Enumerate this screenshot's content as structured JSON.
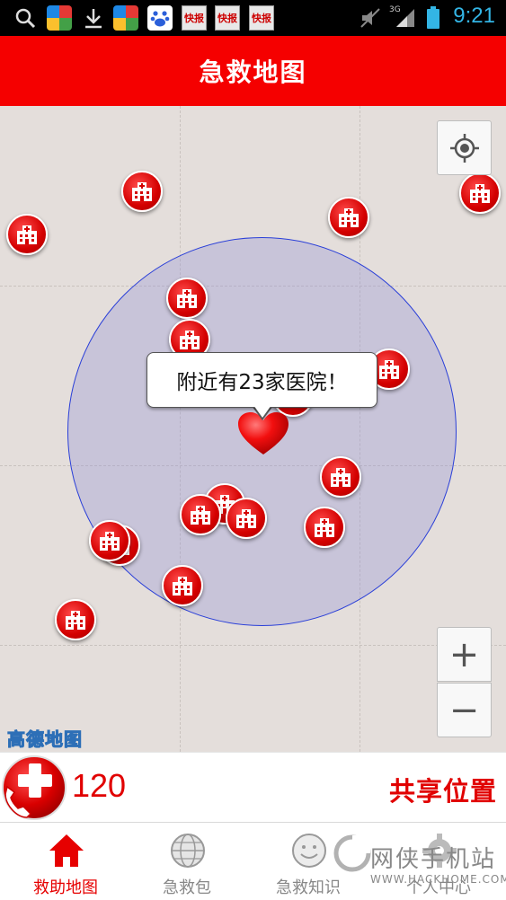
{
  "status_bar": {
    "time": "9:21",
    "network": "3G",
    "kuaibao_label": "快报"
  },
  "header": {
    "title": "急救地图"
  },
  "map": {
    "popup_text": "附近有23家医院！",
    "provider_logo": "高德地图",
    "zoom_in_label": "+",
    "zoom_out_label": "−"
  },
  "call_bar": {
    "number": "120",
    "share_label": "共享位置"
  },
  "nav": {
    "items": [
      {
        "label": "救助地图",
        "icon": "home-icon",
        "active": true
      },
      {
        "label": "急救包",
        "icon": "globe-icon",
        "active": false
      },
      {
        "label": "急救知识",
        "icon": "smile-icon",
        "active": false
      },
      {
        "label": "个人中心",
        "icon": "gear-icon",
        "active": false
      }
    ]
  },
  "watermark": {
    "text": "网侠手机站",
    "url": "WWW.HACKHOME.COM"
  },
  "colors": {
    "accent": "#f50000",
    "radius_stroke": "#2a3fd8",
    "clock": "#33b5e5"
  }
}
